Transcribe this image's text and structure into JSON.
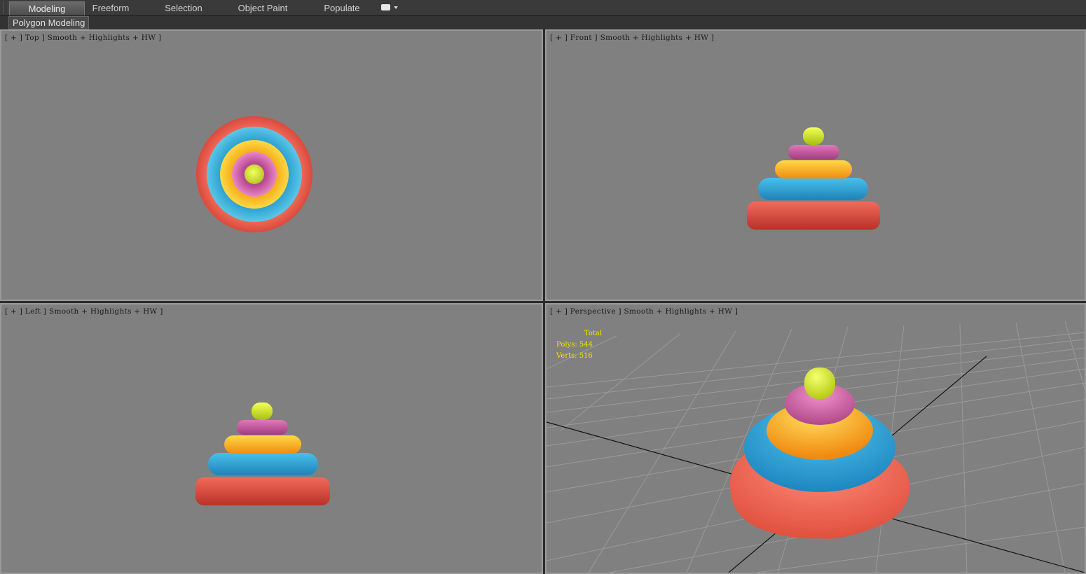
{
  "ribbon": {
    "tabs": [
      "Modeling",
      "Freeform",
      "Selection",
      "Object Paint",
      "Populate"
    ],
    "active_tab": "Modeling",
    "options_icon": "display-options-icon"
  },
  "panel": {
    "label": "Polygon Modeling"
  },
  "viewports": {
    "top": {
      "label": "[ + ] Top ] Smooth + Highlights + HW ]"
    },
    "front": {
      "label": "[ + ] Front ] Smooth + Highlights + HW ]"
    },
    "left": {
      "label": "[ + ] Left ] Smooth + Highlights + HW ]"
    },
    "perspective": {
      "label": "[ + ] Perspective ] Smooth + Highlights + HW ]"
    }
  },
  "stats": {
    "title": "Total",
    "polys": "Polys: 544",
    "verts": "Verts: 516"
  },
  "colors": {
    "ring_red": "#e0574a",
    "ring_blue": "#2aa6d6",
    "ring_yellow": "#f7b820",
    "ring_pink": "#c85aa8",
    "cap_green": "#d6e630",
    "stats_text": "#f5e200",
    "viewport_bg": "#808080"
  }
}
